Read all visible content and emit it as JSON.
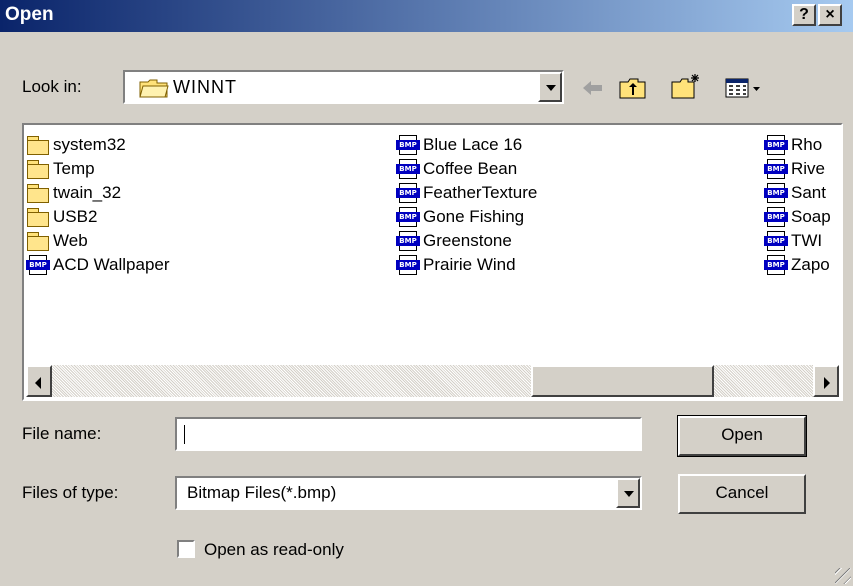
{
  "window": {
    "title": "Open",
    "help_label": "?",
    "close_label": "×"
  },
  "lookin": {
    "label": "Look in:",
    "value": "WINNT"
  },
  "file_list": {
    "items": [
      {
        "name": "system32",
        "icon": "folder-icon"
      },
      {
        "name": "Temp",
        "icon": "folder-icon"
      },
      {
        "name": "twain_32",
        "icon": "folder-icon"
      },
      {
        "name": "USB2",
        "icon": "folder-icon"
      },
      {
        "name": "Web",
        "icon": "folder-icon"
      },
      {
        "name": "ACD Wallpaper",
        "icon": "bmp-file-icon"
      },
      {
        "name": "Blue Lace 16",
        "icon": "bmp-file-icon"
      },
      {
        "name": "Coffee Bean",
        "icon": "bmp-file-icon"
      },
      {
        "name": "FeatherTexture",
        "icon": "bmp-file-icon"
      },
      {
        "name": "Gone Fishing",
        "icon": "bmp-file-icon"
      },
      {
        "name": "Greenstone",
        "icon": "bmp-file-icon"
      },
      {
        "name": "Prairie Wind",
        "icon": "bmp-file-icon"
      },
      {
        "name": "Rho",
        "icon": "bmp-file-icon"
      },
      {
        "name": "Rive",
        "icon": "bmp-file-icon"
      },
      {
        "name": "Sant",
        "icon": "bmp-file-icon"
      },
      {
        "name": "Soap",
        "icon": "bmp-file-icon"
      },
      {
        "name": "TWI",
        "icon": "bmp-file-icon"
      },
      {
        "name": "Zapo",
        "icon": "bmp-file-icon"
      }
    ]
  },
  "filename": {
    "label": "File name:",
    "value": ""
  },
  "filetype": {
    "label": "Files of type:",
    "value": "Bitmap Files(*.bmp)"
  },
  "buttons": {
    "open": "Open",
    "cancel": "Cancel"
  },
  "readonly": {
    "label": "Open as read-only",
    "checked": false
  },
  "icon_badge": "BMP",
  "colors": {
    "titlebar_start": "#0a246a",
    "titlebar_end": "#a6caf0",
    "face": "#d4d0c8",
    "bmp_badge": "#0000c0"
  }
}
